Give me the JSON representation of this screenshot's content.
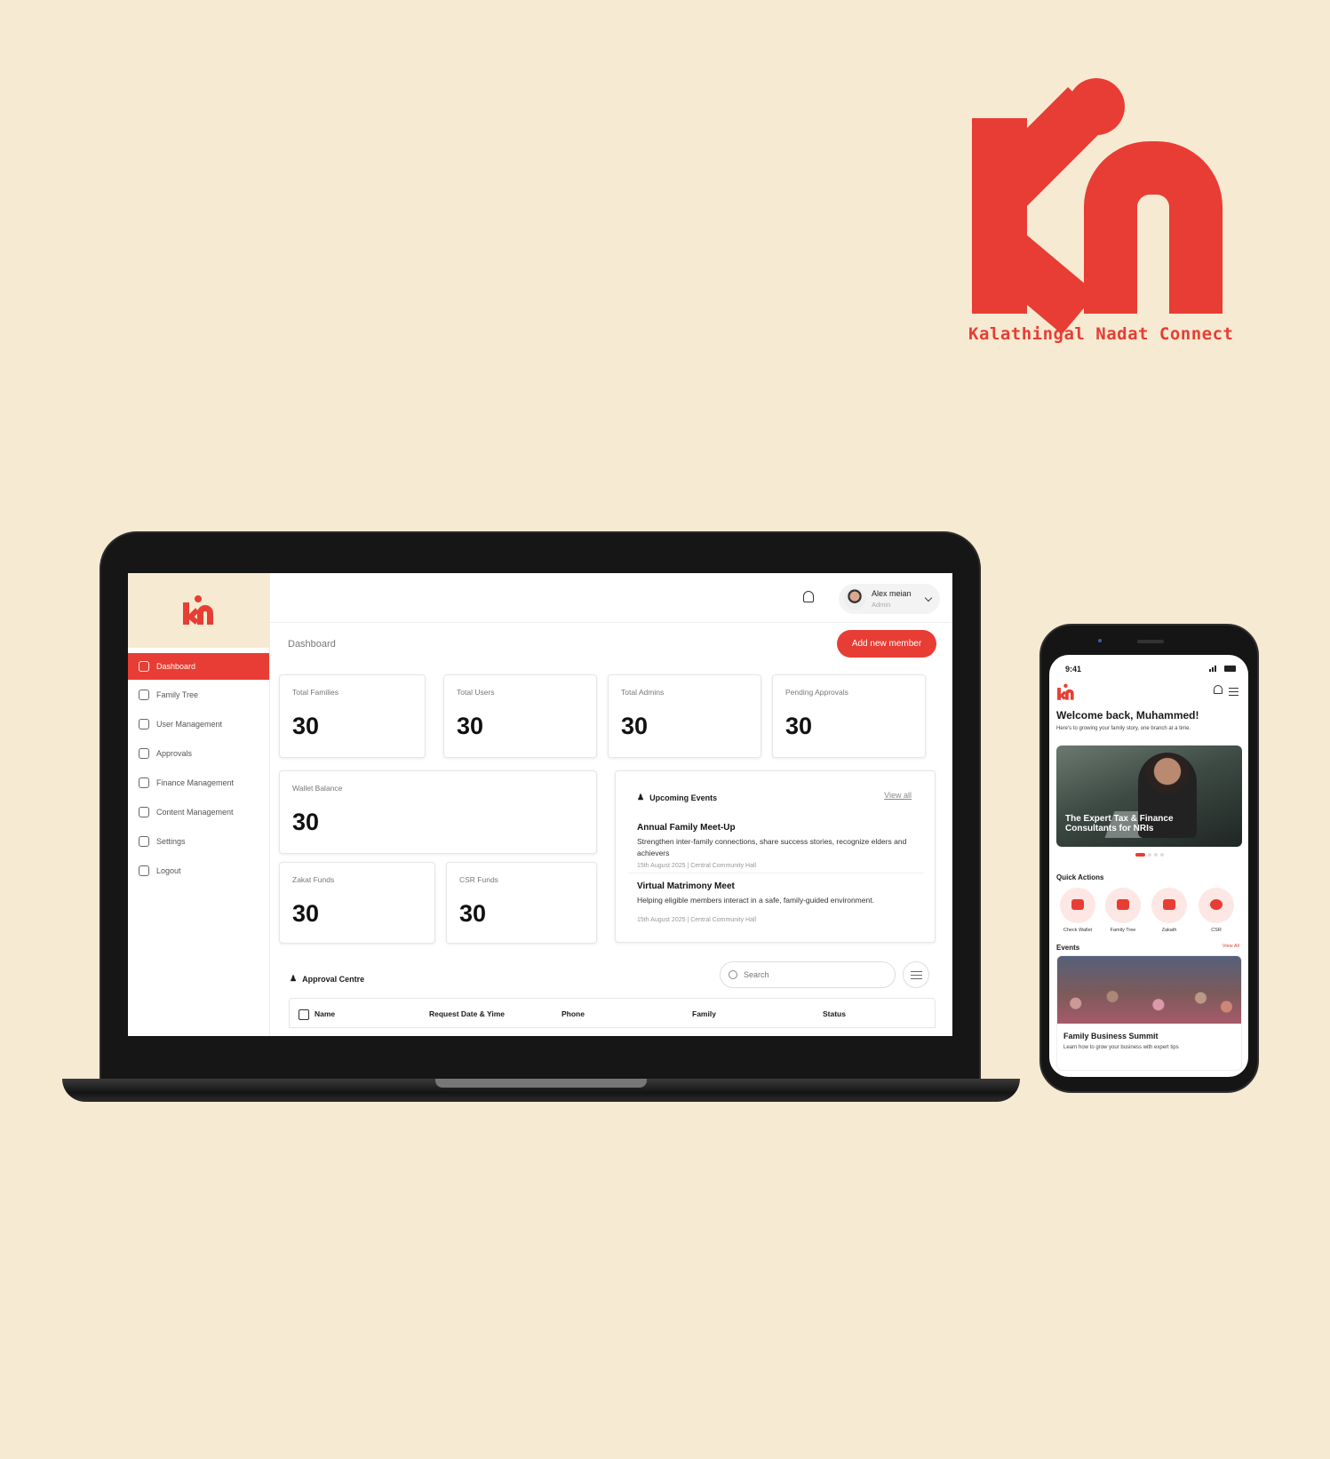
{
  "brand": {
    "tagline": "Kalathingal Nadat Connect",
    "accent": "#e83d34",
    "background": "#f7ead2"
  },
  "laptop": {
    "sidebar": {
      "items": [
        {
          "label": "Dashboard",
          "icon": "grid-icon",
          "active": true
        },
        {
          "label": "Family Tree",
          "icon": "tree-icon"
        },
        {
          "label": "User Management",
          "icon": "users-icon"
        },
        {
          "label": "Approvals",
          "icon": "gavel-icon"
        },
        {
          "label": "Finance Management",
          "icon": "coins-icon"
        },
        {
          "label": "Content Management",
          "icon": "document-icon"
        },
        {
          "label": "Settings",
          "icon": "gear-icon"
        },
        {
          "label": "Logout",
          "icon": "logout-icon"
        }
      ]
    },
    "header": {
      "user_name": "Alex meian",
      "user_role": "Admin"
    },
    "page_title": "Dashboard",
    "add_button": "Add new member",
    "stats": [
      {
        "label": "Total Families",
        "value": "30"
      },
      {
        "label": "Total Users",
        "value": "30"
      },
      {
        "label": "Total Admins",
        "value": "30"
      },
      {
        "label": "Pending Approvals",
        "value": "30"
      },
      {
        "label": "Wallet Balance",
        "value": "30"
      },
      {
        "label": "Zakat Funds",
        "value": "30"
      },
      {
        "label": "CSR Funds",
        "value": "30"
      }
    ],
    "events": {
      "title": "Upcoming Events",
      "view_all": "View all",
      "items": [
        {
          "title": "Annual Family Meet-Up",
          "desc": "Strengthen inter-family connections, share success stories, recognize elders and achievers",
          "meta": "15th August 2025 | Central Community Hall"
        },
        {
          "title": "Virtual Matrimony Meet",
          "desc": "Helping eligible members interact in a safe, family-guided environment.",
          "meta": "15th August 2025 | Central Community Hall"
        }
      ]
    },
    "approval": {
      "title": "Approval Centre",
      "search_placeholder": "Search",
      "columns": [
        "Name",
        "Request Date & Yime",
        "Phone",
        "Family",
        "Status"
      ]
    }
  },
  "phone": {
    "time": "9:41",
    "welcome": "Welcome back, Muhammed!",
    "subtitle": "Here's to growing your family story, one branch at a time.",
    "banner_text": "The Expert Tax & Finance Consultants for NRIs",
    "quick_actions_title": "Quick Actions",
    "quick_actions": [
      {
        "label": "Check Wallet",
        "icon": "wallet-icon"
      },
      {
        "label": "Family Tree",
        "icon": "tree-icon"
      },
      {
        "label": "Zakath",
        "icon": "hand-heart-icon"
      },
      {
        "label": "CSR",
        "icon": "heart-plus-icon"
      }
    ],
    "events_title": "Events",
    "events_view_all": "View All",
    "event": {
      "title": "Family Business Summit",
      "desc": "Learn how to grow your business with expert tips"
    }
  }
}
